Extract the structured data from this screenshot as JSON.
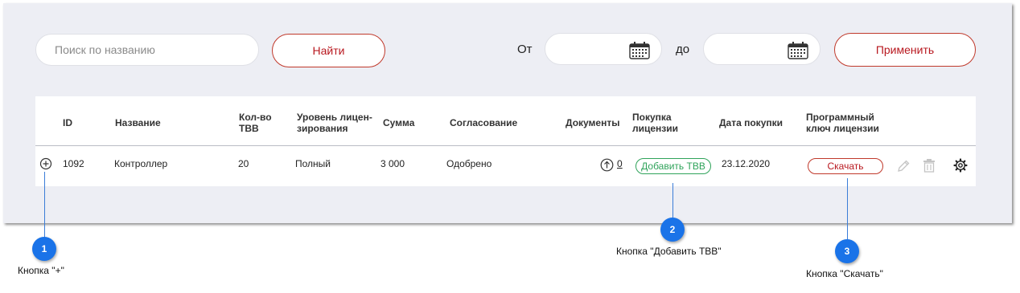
{
  "toolbar": {
    "search_placeholder": "Поиск по названию",
    "find_label": "Найти",
    "from_label": "От",
    "to_label": "до",
    "apply_label": "Применить"
  },
  "table": {
    "headers": {
      "id": "ID",
      "name": "Название",
      "count_line1": "Кол-во",
      "count_line2": "ТВВ",
      "level_line1": "Уровень лицен-",
      "level_line2": "зирования",
      "sum": "Сумма",
      "approval": "Согласование",
      "documents": "Документы",
      "purchase_line1": "Покупка",
      "purchase_line2": "лицензии",
      "purchase_date": "Дата покупки",
      "key_line1": "Программный",
      "key_line2": "ключ лицензии"
    },
    "row": {
      "id": "1092",
      "name": "Контроллер",
      "count": "20",
      "level": "Полный",
      "sum": "3 000",
      "approval": "Одобрено",
      "documents_count": "0",
      "add_tvv_label": "Добавить ТВВ",
      "purchase_date": "23.12.2020",
      "download_label": "Скачать"
    }
  },
  "callouts": [
    {
      "number": "1",
      "caption": "Кнопка \"+\""
    },
    {
      "number": "2",
      "caption": "Кнопка \"Добавить ТВВ\""
    },
    {
      "number": "3",
      "caption": "Кнопка \"Скачать\""
    }
  ],
  "colors": {
    "panel_bg": "#edeef4",
    "accent_red": "#b8181f",
    "accent_green": "#2fa35a",
    "callout_blue": "#1a73e8"
  },
  "icons": [
    "calendar-icon",
    "plus-circle-icon",
    "upload-icon",
    "pencil-icon",
    "trash-icon",
    "gear-icon"
  ]
}
